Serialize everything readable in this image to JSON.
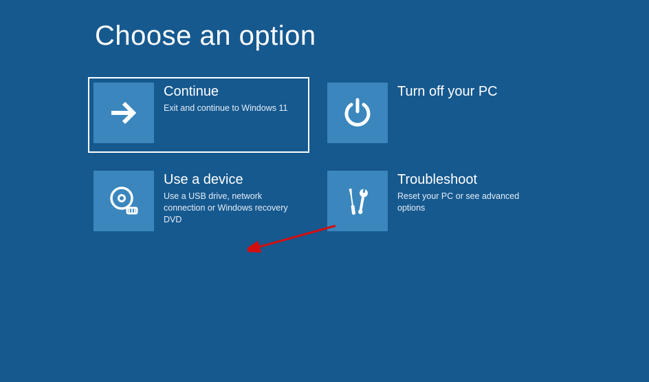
{
  "title": "Choose an option",
  "options": [
    {
      "title": "Continue",
      "desc": "Exit and continue to Windows 11",
      "icon": "arrow-right-icon",
      "selected": true
    },
    {
      "title": "Turn off your PC",
      "desc": "",
      "icon": "power-icon",
      "selected": false
    },
    {
      "title": "Use a device",
      "desc": "Use a USB drive, network connection or Windows recovery DVD",
      "icon": "disc-usb-icon",
      "selected": false
    },
    {
      "title": "Troubleshoot",
      "desc": "Reset your PC or see advanced options",
      "icon": "tools-icon",
      "selected": false
    }
  ],
  "annotation": {
    "type": "red-arrow",
    "target_option_index": 3,
    "color": "#d40e0e"
  }
}
